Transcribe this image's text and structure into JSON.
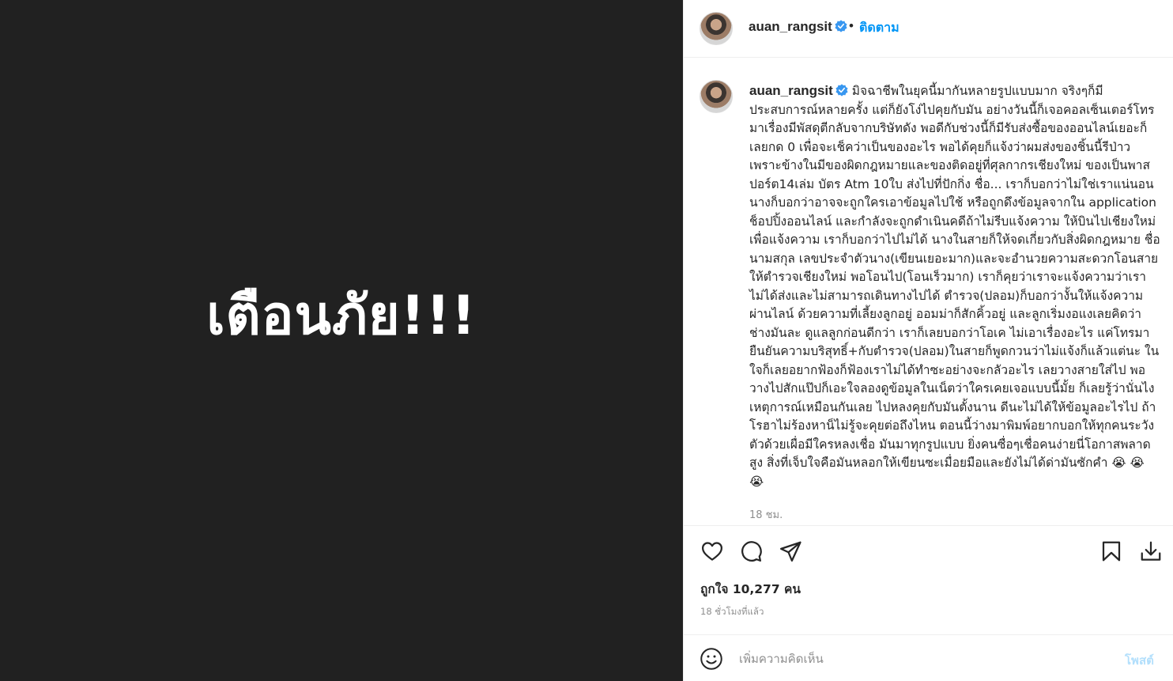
{
  "post": {
    "image_text": "เตือนภัย!!!",
    "username": "auan_rangsit",
    "separator": "•",
    "follow_label": "ติดตาม",
    "caption": "มิจฉาชีพในยุคนี้มากันหลายรูปแบบมาก จริงๆก็มีประสบการณ์หลายครั้ง แต่ก็ยังโง่ไปคุยกับมัน อย่างวันนี้ก็เจอคอลเซ็นเตอร์โทรมาเรื่องมีพัสดุตีกลับจากบริษัทดัง พอดีกับช่วงนี้ก็มีรับส่งซื้อของออนไลน์เยอะก็เลยกด 0 เพื่อจะเช็คว่าเป็นของอะไร พอได้คุยก็แจ้งว่าผมส่งของชิ้นนี้รีป่าว เพราะข้างในมีของผิดกฎหมายและของติดอยู่ที่ศุลกากรเชียงใหม่ ของเป็นพาสปอร์ต14เล่ม บัตร Atm 10ใบ ส่งไปที่ปักกิ่ง ชื่อ... เราก็บอกว่าไม่ใช่เราแน่นอน นางก็บอกว่าอาจจะถูกใครเอาข้อมูลไปใช้ หรือถูกดึงข้อมูลจากใน application ช็อปปิ้งออนไลน์ และกำลังจะถูกดำเนินคดีถ้าไม่รีบแจ้งความ ให้บินไปเชียงใหม่เพื่อแจ้งความ เราก็บอกว่าไปไม่ได้ นางในสายก็ให้จดเกี่ยวกับสิ่งผิดกฎหมาย ชื่อนามสกุล เลขประจำตัวนาง(เขียนเยอะมาก)และจะอำนวยความสะดวกโอนสายให้ตำรวจเชียงใหม่ พอโอนไป(โอนเร็วมาก) เราก็คุยว่าเราจะแจ้งความว่าเราไม่ได้ส่งและไม่สามารถเดินทางไปได้ ตำรวจ(ปลอม)ก็บอกว่างั้นให้แจ้งความผ่านไลน์ ด้วยความที่เลี้ยงลูกอยู่ ออมม่าก็สักคิ้วอยู่ และลูกเริ่มงอแงเลยคิดว่าช่างมันละ ดูแลลูกก่อนดีกว่า เราก็เลยบอกว่าโอเค ไม่เอาเรื่องอะไร แค่โทรมายืนยันความบริสุทธิ์+กับตำรวจ(ปลอม)ในสายก็พูดกวนว่าไม่แจ้งก็แล้วแต่นะ ในใจก็เลยอยากฟ้องก็ฟ้องเราไม่ได้ทำซะอย่างจะกลัวอะไร เลยวางสายใส่ไป พอวางไปสักแป๊ปก็เอะใจลองดูข้อมูลในเน็ตว่าใครเคยเจอแบบนี้มั้ย ก็เลยรู้ว่านั่นไง เหตุการณ์เหมือนกันเลย ไปหลงคุยกับมันตั้งนาน ดีนะไม่ได้ให้ข้อมูลอะไรไป ถ้าโรฮาไม่ร้องหาน็ไม่รู้จะคุยต่อถึงไหน ตอนนี้ว่างมาพิมพ์อยากบอกให้ทุกคนระวังตัวด้วยเผื่อมีใครหลงเชื่อ มันมาทุกรูปแบบ ยิ่งคนซื่อๆเชื่อคนง่ายนี่โอกาสพลาดสูง สิ่งที่เจ็บใจคือมันหลอกให้เขียนซะเมื่อยมือและยังไม่ได้ด่ามันซักคำ 😭 😭 😭",
    "caption_time": "18 ชม.",
    "likes_text": "ถูกใจ 10,277 คน",
    "post_time": "18 ชั่วโมงที่แล้ว",
    "comment_placeholder": "เพิ่มความคิดเห็น",
    "post_button": "โพสต์"
  },
  "icons": {
    "verified": "verified-badge-icon",
    "like": "heart-icon",
    "comment": "comment-bubble-icon",
    "share": "paper-plane-icon",
    "save": "bookmark-icon",
    "download": "download-icon",
    "emoji": "smiley-icon"
  },
  "colors": {
    "media_bg": "#212121",
    "accent": "#0095f6",
    "post_button_disabled": "#b2dffc",
    "muted_text": "#8e8e8e"
  }
}
